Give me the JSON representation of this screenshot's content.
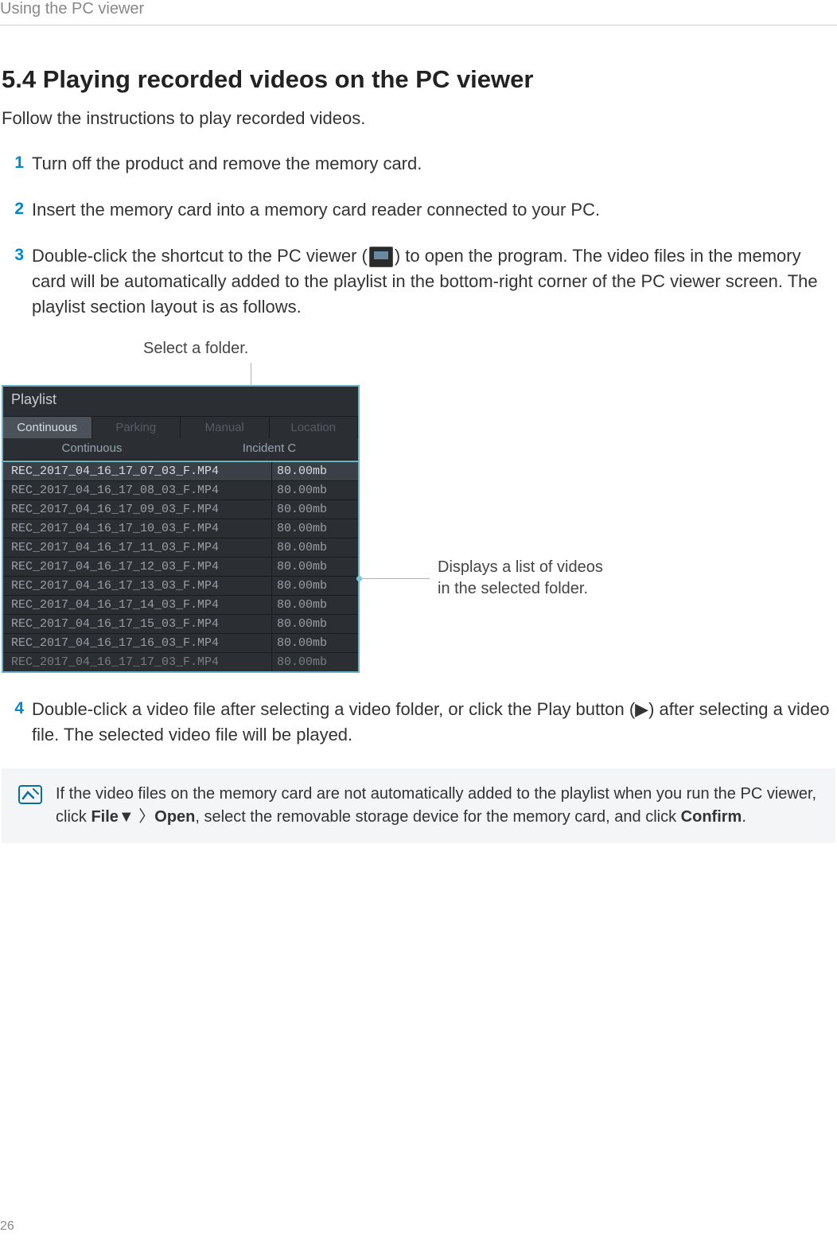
{
  "header": {
    "breadcrumb": "Using the PC viewer"
  },
  "section": {
    "heading": "5.4   Playing recorded videos on the PC viewer",
    "intro": "Follow the instructions to play recorded videos."
  },
  "steps": {
    "s1": {
      "num": "1",
      "text": "Turn off the product and remove the memory card."
    },
    "s2": {
      "num": "2",
      "text": "Insert the memory card into a memory card reader connected to your PC."
    },
    "s3": {
      "num": "3",
      "text_a": "Double-click the shortcut to the PC viewer (",
      "text_b": ") to open the program. The video files in the memory card will be automatically added to the playlist in the bottom-right corner of the PC viewer screen. The playlist section layout is as follows."
    },
    "s4": {
      "num": "4",
      "text": "Double-click a video file after selecting a video folder, or click the Play button (▶) after selecting a video file. The selected video file will be played."
    }
  },
  "figure": {
    "annot_top": "Select a folder.",
    "annot_right_l1": "Displays a list of videos",
    "annot_right_l2": "in the selected folder.",
    "playlist_title": "Playlist",
    "tabs": [
      "Continuous",
      "Parking",
      "Manual",
      "Location"
    ],
    "subtabs": [
      "Continuous",
      "Incident C"
    ],
    "files": [
      {
        "name": "REC_2017_04_16_17_07_03_F.MP4",
        "size": "80.00mb"
      },
      {
        "name": "REC_2017_04_16_17_08_03_F.MP4",
        "size": "80.00mb"
      },
      {
        "name": "REC_2017_04_16_17_09_03_F.MP4",
        "size": "80.00mb"
      },
      {
        "name": "REC_2017_04_16_17_10_03_F.MP4",
        "size": "80.00mb"
      },
      {
        "name": "REC_2017_04_16_17_11_03_F.MP4",
        "size": "80.00mb"
      },
      {
        "name": "REC_2017_04_16_17_12_03_F.MP4",
        "size": "80.00mb"
      },
      {
        "name": "REC_2017_04_16_17_13_03_F.MP4",
        "size": "80.00mb"
      },
      {
        "name": "REC_2017_04_16_17_14_03_F.MP4",
        "size": "80.00mb"
      },
      {
        "name": "REC_2017_04_16_17_15_03_F.MP4",
        "size": "80.00mb"
      },
      {
        "name": "REC_2017_04_16_17_16_03_F.MP4",
        "size": "80.00mb"
      },
      {
        "name": "REC_2017_04_16_17_17_03_F.MP4",
        "size": "80.00mb"
      }
    ]
  },
  "note": {
    "text_a": "If the video files on the memory card are not automatically added to the playlist when you run the PC viewer, click ",
    "bold_a": "File▼",
    "sep": " 〉",
    "bold_b": "Open",
    "text_b": ", select the removable storage device for the memory card, and click ",
    "bold_c": "Confirm",
    "text_c": "."
  },
  "page_number": "26"
}
